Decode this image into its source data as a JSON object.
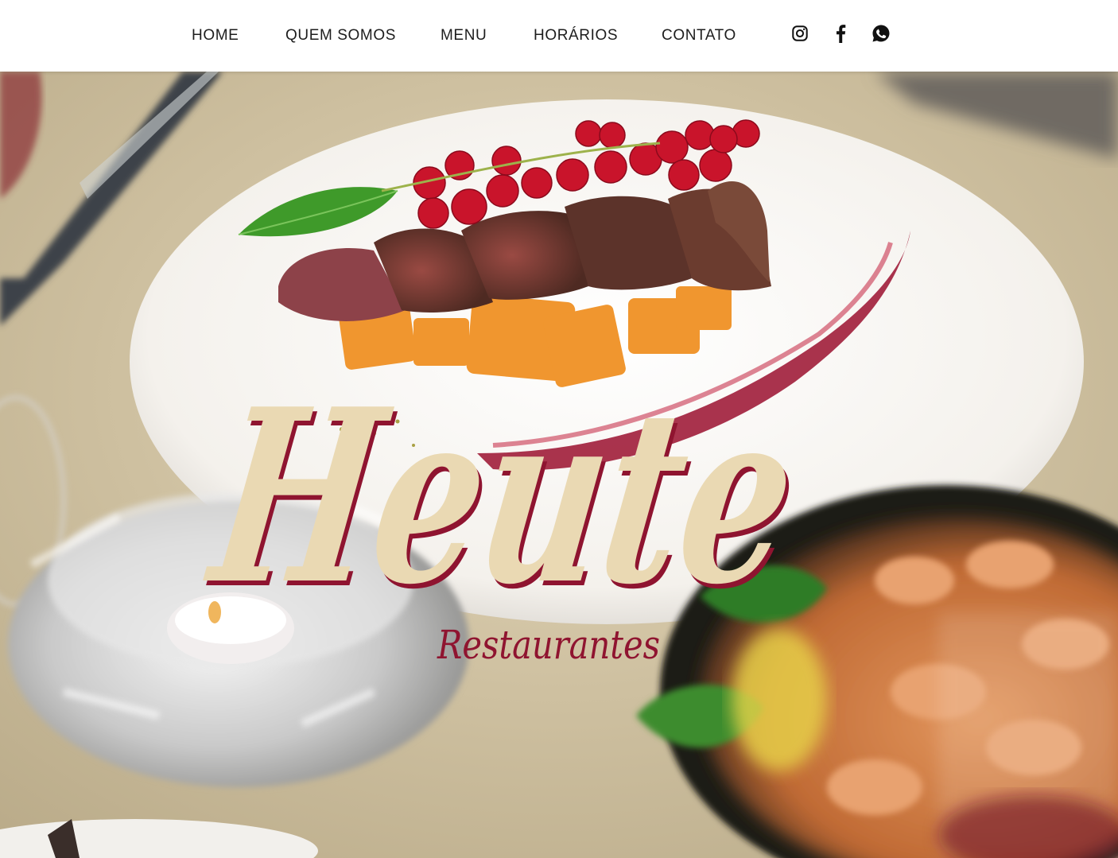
{
  "nav": {
    "items": [
      {
        "label": "HOME"
      },
      {
        "label": "QUEM SOMOS"
      },
      {
        "label": "MENU"
      },
      {
        "label": "HORÁRIOS"
      },
      {
        "label": "CONTATO"
      }
    ],
    "social": [
      {
        "icon": "instagram-icon"
      },
      {
        "icon": "facebook-icon"
      },
      {
        "icon": "whatsapp-icon"
      }
    ]
  },
  "hero": {
    "logo_title": "Heute",
    "logo_subtitle": "Restaurantes"
  },
  "colors": {
    "logo_cream": "#ead9b3",
    "logo_burgundy": "#8f1430",
    "nav_text": "#1d1d1d",
    "nav_bg": "#ffffff"
  }
}
